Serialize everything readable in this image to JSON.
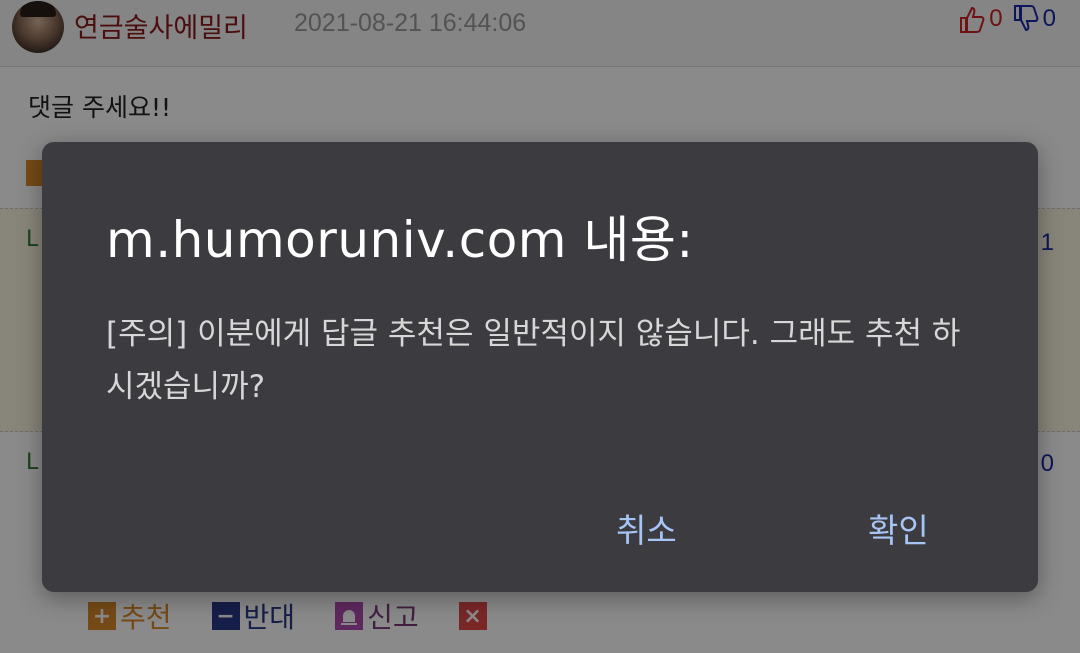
{
  "post": {
    "username": "연금술사에밀리",
    "timestamp": "2021-08-21 16:44:06",
    "upvotes": "0",
    "downvotes": "0",
    "comment_text": "댓글 주세요!!"
  },
  "replies": [
    {
      "marker": "L",
      "count": "1"
    },
    {
      "marker": "L",
      "count": "0"
    }
  ],
  "actions": {
    "recommend_label": "추천",
    "oppose_label": "반대",
    "report_label": "신고",
    "plus_symbol": "+",
    "minus_symbol": "−",
    "close_symbol": "×"
  },
  "dialog": {
    "title": "m.humoruniv.com 내용:",
    "message": "[주의] 이분에게 답글 추천은 일반적이지 않습니다. 그래도 추천 하시겠습니까?",
    "cancel_label": "취소",
    "ok_label": "확인"
  },
  "colors": {
    "dialog_bg": "#3c3b40",
    "button_text": "#a7c5f4",
    "username": "#8b1a1a",
    "upvote": "#cc2222",
    "downvote": "#1a2aa8"
  },
  "icons": [
    "thumbs-up-icon",
    "thumbs-down-icon",
    "plus-icon",
    "minus-icon",
    "siren-icon",
    "close-icon"
  ]
}
